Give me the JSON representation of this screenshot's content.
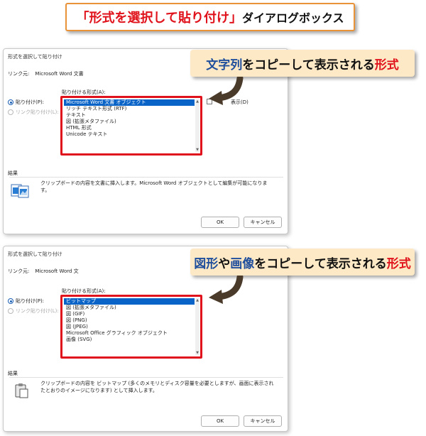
{
  "banner": {
    "part1": "「形式を選択して貼り付け」",
    "part2": "ダイアログボックス"
  },
  "colors": {
    "accent_red": "#e0121b",
    "banner_border": "#e8923a",
    "callout_bg": "#fde9c6",
    "callout_blue": "#1f4e9c",
    "selection_blue": "#0a64c8"
  },
  "dialog1": {
    "title": "形式を選択して貼り付け",
    "source_label": "リンク元:",
    "source_value": "Microsoft Word 文書",
    "paste_label": "貼り付け(P):",
    "link_label": "リンク貼り付け(L):",
    "as_label": "貼り付ける形式(A):",
    "items": [
      "Microsoft Word 文書 オブジェクト",
      "リッチ テキスト形式 (RTF)",
      "テキスト",
      "図 (拡張メタファイル)",
      "HTML 形式",
      "Unicode テキスト"
    ],
    "selected_index": 0,
    "icon_label": "表示(D)",
    "result_label": "結果",
    "result_text": "クリップボードの内容を文書に挿入します。Microsoft Word オブジェクトとして編集が可能になります。",
    "ok": "OK",
    "cancel": "キャンセル"
  },
  "dialog2": {
    "title": "形式を選択して貼り付け",
    "source_label": "リンク元:",
    "source_value": "Microsoft Word 文",
    "paste_label": "貼り付け(P):",
    "link_label": "リンク貼り付け(L):",
    "as_label": "貼り付ける形式(A):",
    "items": [
      "ビットマップ",
      "図 (拡張メタファイル)",
      "図 (GIF)",
      "図 (PNG)",
      "図 (JPEG)",
      "Microsoft Office グラフィック オブジェクト",
      "画像 (SVG)"
    ],
    "selected_index": 0,
    "result_label": "結果",
    "result_text": "クリップボードの内容を ビットマップ (多くのメモリとディスク容量を必要としますが、画面に表示されたとおりのイメージになります) として挿入します。",
    "ok": "OK",
    "cancel": "キャンセル"
  },
  "callout1": {
    "w1": "文字列",
    "w2": "をコピーして表示される",
    "w3": "形式"
  },
  "callout2": {
    "w1": "図形",
    "w2": "や",
    "w3": "画像",
    "w4": "をコピーして表示される",
    "w5": "形式"
  }
}
